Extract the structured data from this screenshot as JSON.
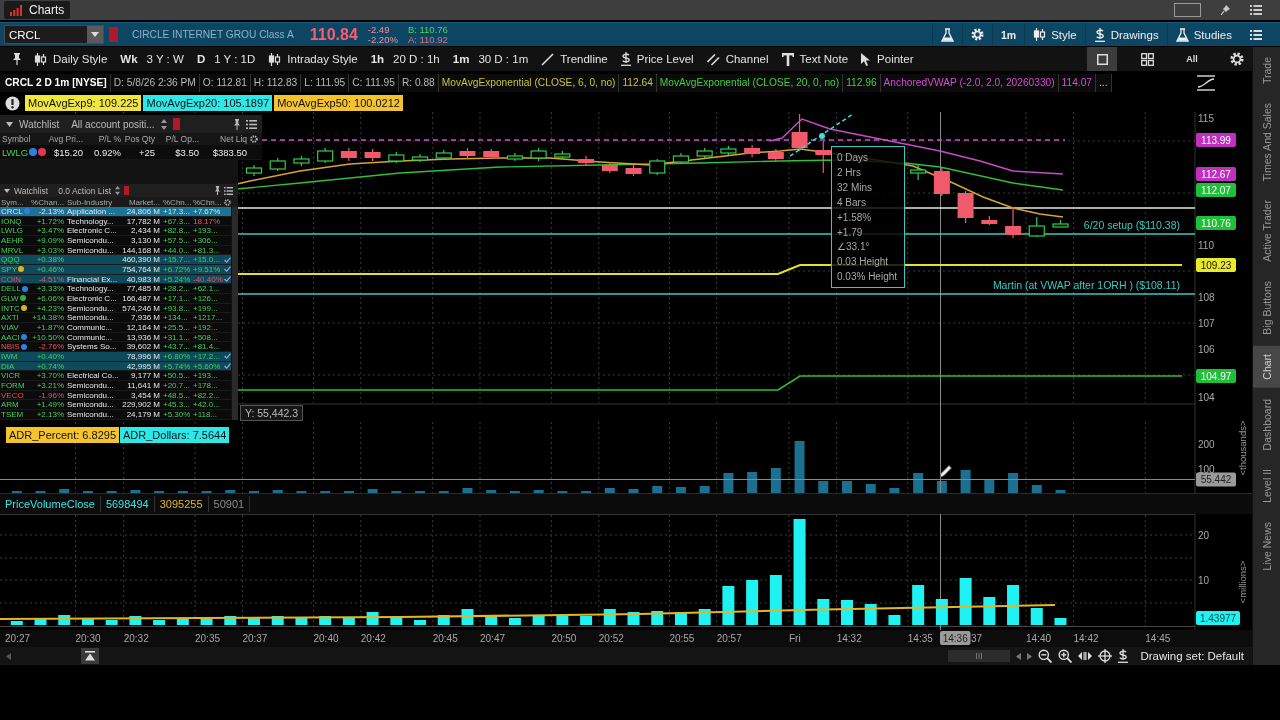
{
  "window": {
    "title": "Charts"
  },
  "symbol_bar": {
    "symbol": "CRCL",
    "company": "CIRCLE INTERNET GROU Class A",
    "last": "110.84",
    "change": "-2.49",
    "change_percent": "-2.20%",
    "bid": "B: 110.76",
    "ask": "A: 110.92",
    "buttons": [
      "1m",
      "Style",
      "Drawings",
      "Studies"
    ]
  },
  "toolbar": {
    "presets": [
      {
        "kind": "style",
        "label": "Daily Style"
      },
      {
        "kind": "range",
        "tag": "Wk",
        "label": "3 Y : W"
      },
      {
        "kind": "range",
        "tag": "D",
        "label": "1 Y : 1D"
      },
      {
        "kind": "style",
        "label": "Intraday Style"
      },
      {
        "kind": "range",
        "tag": "1h",
        "label": "20 D : 1h"
      },
      {
        "kind": "range",
        "tag": "1m",
        "label": "30 D : 1m"
      }
    ],
    "tools": [
      "Trendline",
      "Price Level",
      "Channel",
      "Text Note",
      "Pointer"
    ],
    "views": [
      {
        "kind": "single",
        "selected": true
      },
      {
        "kind": "grid",
        "selected": false
      },
      {
        "kind": "text",
        "label": "All",
        "selected": false
      }
    ]
  },
  "chart_header": {
    "title": "CRCL 2 D 1m [NYSE]",
    "fields": [
      "D: 5/8/26 2:36 PM",
      "O: 112.81",
      "H: 112.83",
      "L: 111.95",
      "C: 111.95",
      "R: 0.88"
    ],
    "studies": [
      {
        "name": "MovAvgExponential (CLOSE, 6, 0, no)",
        "value": "112.64",
        "color": "#c9c23a"
      },
      {
        "name": "MovAvgExponential (CLOSE, 20, 0, no)",
        "value": "112.96",
        "color": "#3fd03f"
      },
      {
        "name": "AnchoredVWAP (-2.0, 2.0, 20260330)",
        "value": "114.07",
        "color": "#d448d4"
      }
    ],
    "more": "..."
  },
  "study_badges": [
    {
      "text": "MovAvgExp9: 109.225",
      "color": "#f0e63c"
    },
    {
      "text": "MovAvgExp20: 105.1897",
      "color": "#2ee8e8"
    },
    {
      "text": "MovAvgExp50: 100.0212",
      "color": "#f5c42c"
    }
  ],
  "price_chart": {
    "axis_labels": [
      "115",
      "110",
      "108",
      "107",
      "106",
      "104"
    ],
    "price_tags": [
      {
        "text": "113.99",
        "color": "#c030c0"
      },
      {
        "text": "112.67",
        "color": "#c030c0"
      },
      {
        "text": "112.07",
        "color": "#1fbf3a"
      },
      {
        "text": "110.76",
        "color": "#1fbf3a"
      },
      {
        "text": "109.23",
        "color": "#eaea28"
      },
      {
        "text": "104.97",
        "color": "#1fbf3a"
      }
    ],
    "annotations": [
      "6/20 setup ($110.38)",
      "Martin (at VWAP after 1ORH ) ($108.11)"
    ],
    "measurement": [
      "0 Days",
      "2 Hrs",
      "32 Mins",
      "4 Bars",
      "+1.58%",
      "+1.79",
      "∠33.1°",
      "0.03 Height",
      "0.03% Height"
    ],
    "cursor_readout": "Y: 55,442.3"
  },
  "positions_watchlist": {
    "title": "Watchlist",
    "list": "All account positi...",
    "columns": [
      "Symbol",
      "Avg Pri...",
      "P/L %",
      "Pos Qty",
      "P/L Op...",
      "Net Liq"
    ],
    "rows": [
      {
        "cells": [
          "LWLG",
          "$15.20",
          "0.92%",
          "+25",
          "$3.50",
          "$383.50"
        ],
        "badges": [
          {
            "color": "#2f7fe0"
          },
          {
            "color": "#e0384c"
          }
        ]
      }
    ]
  },
  "watchlist": {
    "title": "Watchlist",
    "list": "0.0 Action List",
    "columns": [
      "Sym...",
      "%Chan...",
      "Sub-Industry",
      "Market...",
      "%Chn...",
      "%Chn..."
    ],
    "rows": [
      {
        "cells": [
          "CRCL",
          "-2.13%",
          "Application ...",
          "24,806 M",
          "+17.3...",
          "+7.67%"
        ],
        "badges": [
          {
            "color": "#2f7fe0"
          }
        ],
        "selected": true,
        "checked": false,
        "falling": true,
        "last_falling": false
      },
      {
        "cells": [
          "IONQ",
          "+1.72%",
          "Technology...",
          "17,782 M",
          "+67.3...",
          "18.17%"
        ],
        "selected": false,
        "checked": false,
        "falling": false,
        "last_falling": true
      },
      {
        "cells": [
          "LWLG",
          "+3.47%",
          "Electronic C...",
          "2,434 M",
          "+82.8...",
          "+193..."
        ],
        "selected": false,
        "checked": false,
        "falling": false,
        "last_falling": false
      },
      {
        "cells": [
          "AEHR",
          "+9.09%",
          "Semicondu...",
          "3,130 M",
          "+57.5...",
          "+306..."
        ],
        "selected": false,
        "checked": false,
        "falling": false,
        "last_falling": false
      },
      {
        "cells": [
          "MRVL",
          "+3.03%",
          "Semicondu...",
          "144,168 M",
          "+44.0...",
          "+81.3..."
        ],
        "selected": false,
        "checked": false,
        "falling": false,
        "last_falling": false
      },
      {
        "cells": [
          "QQQ",
          "+0.38%",
          "",
          "460,390 M",
          "+15.7...",
          "+15.0..."
        ],
        "selected": false,
        "checked": true,
        "falling": false,
        "last_falling": false
      },
      {
        "cells": [
          "SPY",
          "+0.46%",
          "",
          "754,764 M",
          "+6.72%",
          "+9.51%"
        ],
        "badges": [
          {
            "color": "#e0b020"
          }
        ],
        "selected": false,
        "checked": true,
        "falling": false,
        "last_falling": false
      },
      {
        "cells": [
          "COIN",
          "-4.51%",
          "Financial Ex...",
          "40,983 M",
          "+5.24%",
          "-40.40%"
        ],
        "selected": false,
        "checked": true,
        "falling": true,
        "last_falling": true
      },
      {
        "cells": [
          "DELL",
          "+3.33%",
          "Technology...",
          "77,485 M",
          "+28.2...",
          "+62.1..."
        ],
        "badges": [
          {
            "color": "#2f7fe0"
          }
        ],
        "selected": false,
        "checked": false,
        "falling": false,
        "last_falling": false
      },
      {
        "cells": [
          "GLW",
          "+6.06%",
          "Electronic C...",
          "166,487 M",
          "+17.1...",
          "+126..."
        ],
        "badges": [
          {
            "color": "#30b040"
          }
        ],
        "selected": false,
        "checked": false,
        "falling": false,
        "last_falling": false
      },
      {
        "cells": [
          "INTC",
          "+4.23%",
          "Semicondu...",
          "574,246 M",
          "+93.8...",
          "+199..."
        ],
        "badges": [
          {
            "color": "#e0b020"
          }
        ],
        "selected": false,
        "checked": false,
        "falling": false,
        "last_falling": false
      },
      {
        "cells": [
          "AXTI",
          "+14.38%",
          "Semicondu...",
          "7,936 M",
          "+134...",
          "+1217..."
        ],
        "selected": false,
        "checked": false,
        "falling": false,
        "last_falling": false
      },
      {
        "cells": [
          "VIAV",
          "+1.87%",
          "Communic...",
          "12,164 M",
          "+25.5...",
          "+192..."
        ],
        "selected": false,
        "checked": false,
        "falling": false,
        "last_falling": false
      },
      {
        "cells": [
          "AACI",
          "+10.50%",
          "Communic...",
          "13,936 M",
          "+31.1...",
          "+508..."
        ],
        "badges": [
          {
            "color": "#2f7fe0"
          }
        ],
        "selected": false,
        "checked": false,
        "falling": false,
        "last_falling": false
      },
      {
        "cells": [
          "NBIS",
          "-2.76%",
          "Systems So...",
          "39,602 M",
          "+43.7...",
          "+81.4..."
        ],
        "badges": [
          {
            "color": "#2f7fe0"
          }
        ],
        "selected": false,
        "checked": false,
        "falling": true,
        "last_falling": false
      },
      {
        "cells": [
          "IWM",
          "+0.40%",
          "",
          "78,996 M",
          "+6.80%",
          "+17.2..."
        ],
        "selected": false,
        "checked": true,
        "falling": false,
        "last_falling": false
      },
      {
        "cells": [
          "DIA",
          "+0.74%",
          "",
          "42,995 M",
          "+5.74%",
          "+5.60%"
        ],
        "selected": false,
        "checked": true,
        "falling": false,
        "last_falling": false
      },
      {
        "cells": [
          "VICR",
          "+3.70%",
          "Electrical Co...",
          "9,177 M",
          "+50.5...",
          "+193..."
        ],
        "selected": false,
        "checked": false,
        "falling": false,
        "last_falling": false
      },
      {
        "cells": [
          "FORM",
          "+3.21%",
          "Semicondu...",
          "11,641 M",
          "+20.7...",
          "+178..."
        ],
        "selected": false,
        "checked": false,
        "falling": false,
        "last_falling": false
      },
      {
        "cells": [
          "VECO",
          "-1.96%",
          "Semicondu...",
          "3,454 M",
          "+48.5...",
          "+82.2..."
        ],
        "selected": false,
        "checked": false,
        "falling": true,
        "last_falling": false
      },
      {
        "cells": [
          "ARM",
          "+1.49%",
          "Semicondu...",
          "229,902 M",
          "+45.3...",
          "+42.0..."
        ],
        "selected": false,
        "checked": false,
        "falling": false,
        "last_falling": false
      },
      {
        "cells": [
          "TSEM",
          "+2.13%",
          "Semicondu...",
          "24,179 M",
          "+5.30%",
          "+118..."
        ],
        "selected": false,
        "checked": false,
        "falling": false,
        "last_falling": false
      }
    ]
  },
  "volume_pane": {
    "studies": [
      {
        "text": "ADR_Percent: 6.8295",
        "color": "#f5c42c"
      },
      {
        "text": "ADR_Dollars: 7.5644",
        "color": "#2ee8e8"
      }
    ],
    "axis_labels": [
      "200",
      "100"
    ],
    "cursor_value": "55.442",
    "unit": "<thousands>"
  },
  "price_volume_pane": {
    "title": "PriceVolumeClose",
    "values": [
      {
        "text": "5698494",
        "color": "#2ee8e8"
      },
      {
        "text": "3095255",
        "color": "#e6b422"
      },
      {
        "text": "50901",
        "color": "#8a8a8a"
      }
    ],
    "axis_labels": [
      "20",
      "10"
    ],
    "last_value": "1.43977",
    "unit": "<millions>"
  },
  "time_axis": {
    "labels": [
      "20:27",
      "20:30",
      "20:32",
      "20:35",
      "20:37",
      "20:40",
      "20:42",
      "20:45",
      "20:47",
      "20:50",
      "20:52",
      "20:55",
      "20:57",
      "Fri",
      "14:32",
      "14:35",
      "37",
      "14:40",
      "14:42",
      "14:45"
    ],
    "cursor_time": "14:36"
  },
  "status_bar": {
    "drawing_set": "Drawing set: Default"
  },
  "side_tabs": [
    {
      "label": "Trade",
      "selected": false
    },
    {
      "label": "Times And Sales",
      "selected": false
    },
    {
      "label": "Active Trader",
      "selected": false
    },
    {
      "label": "Big Buttons",
      "selected": false
    },
    {
      "label": "Chart",
      "selected": true
    },
    {
      "label": "Dashboard",
      "selected": false
    },
    {
      "label": "Level II",
      "selected": false
    },
    {
      "label": "Live News",
      "selected": false
    }
  ]
}
